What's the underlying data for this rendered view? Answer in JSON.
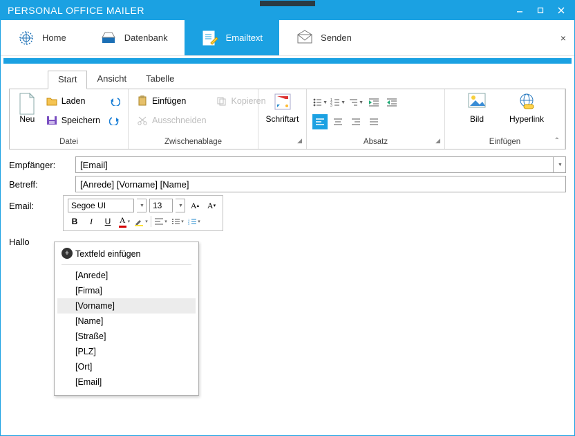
{
  "title": "PERSONAL OFFICE MAILER",
  "nav": {
    "home": "Home",
    "datenbank": "Datenbank",
    "emailtext": "Emailtext",
    "senden": "Senden"
  },
  "subtabs": {
    "start": "Start",
    "ansicht": "Ansicht",
    "tabelle": "Tabelle"
  },
  "ribbon": {
    "datei": {
      "neu": "Neu",
      "laden": "Laden",
      "speichern": "Speichern",
      "group": "Datei"
    },
    "zwischen": {
      "einfuegen": "Einfügen",
      "kopieren": "Kopieren",
      "ausschneiden": "Ausschneiden",
      "group": "Zwischenablage"
    },
    "schriftart": {
      "label": "Schriftart",
      "group_icon": "A"
    },
    "absatz": {
      "group": "Absatz"
    },
    "einfuegen": {
      "bild": "Bild",
      "hyperlink": "Hyperlink",
      "group": "Einfügen"
    }
  },
  "form": {
    "recipient_label": "Empfänger:",
    "recipient_value": "[Email]",
    "subject_label": "Betreff:",
    "subject_value": "[Anrede] [Vorname] [Name]",
    "email_label": "Email:"
  },
  "editor": {
    "font": "Segoe UI",
    "size": "13",
    "grow": "A",
    "grow_sup": "▴",
    "shrink": "A",
    "shrink_sup": "▾",
    "bold": "B",
    "italic": "I",
    "underline": "U"
  },
  "body_text": "Hallo",
  "context": {
    "header": "Textfeld einfügen",
    "items": [
      "[Anrede]",
      "[Firma]",
      "[Vorname]",
      "[Name]",
      "[Straße]",
      "[PLZ]",
      "[Ort]",
      "[Email]"
    ],
    "highlight_index": 2
  }
}
